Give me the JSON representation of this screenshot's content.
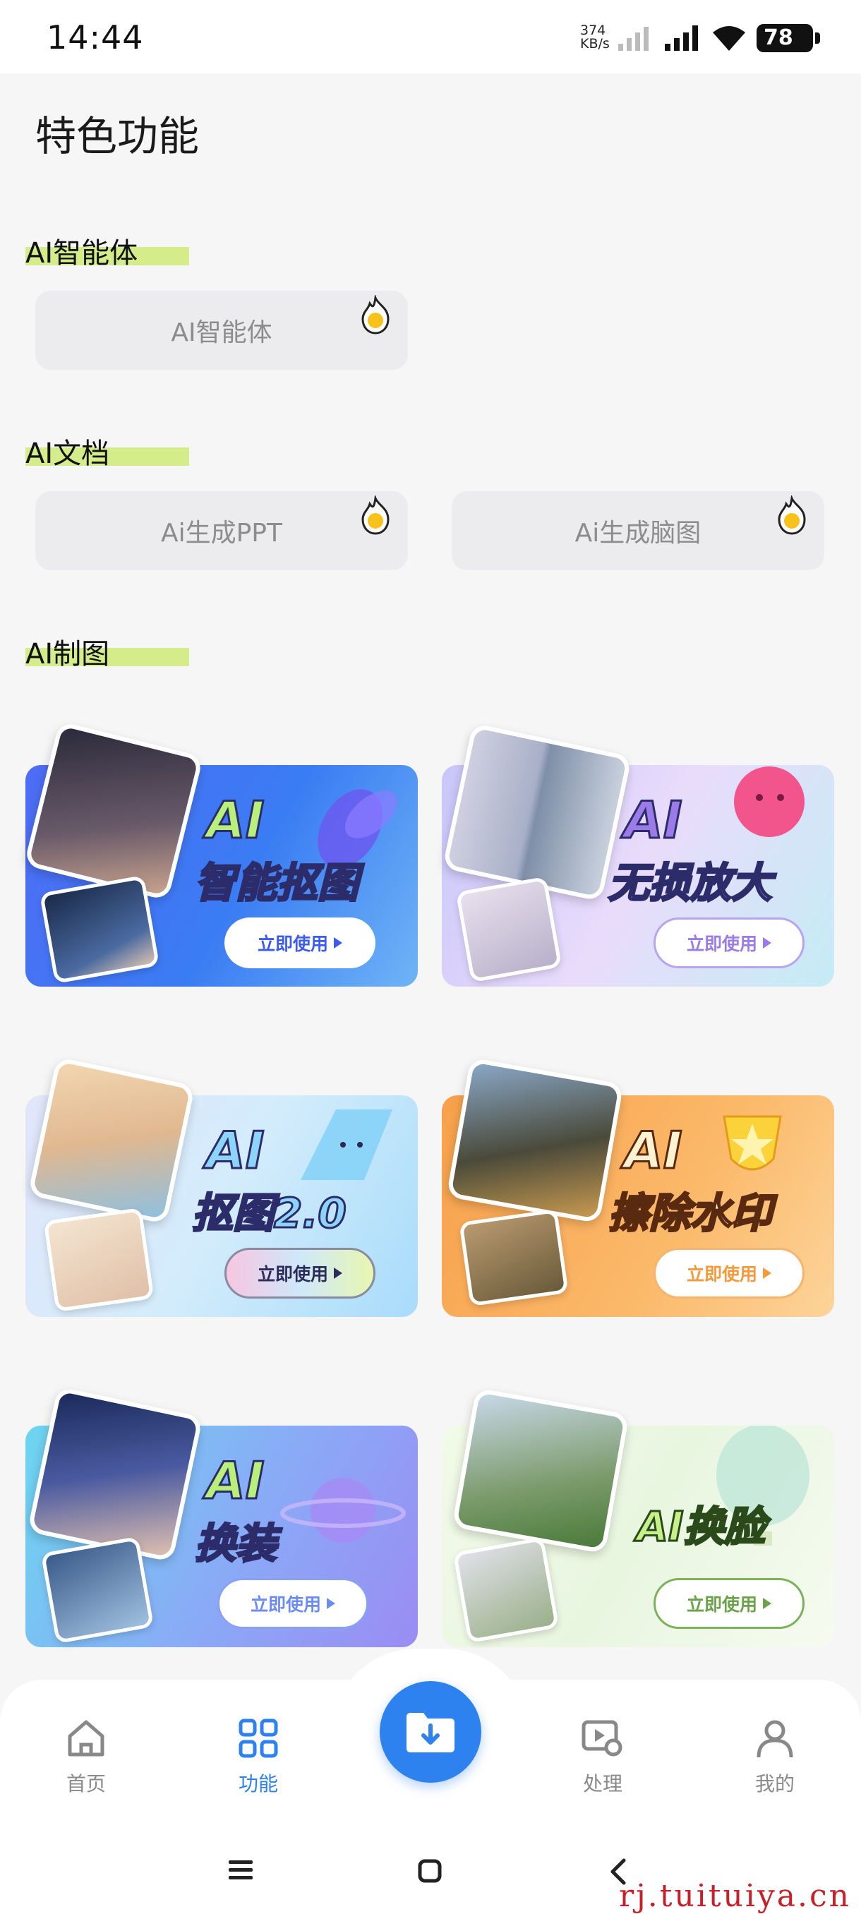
{
  "status_bar": {
    "time": "14:44",
    "net_speed_value": "374",
    "net_speed_unit": "KB/s",
    "battery": "78"
  },
  "page": {
    "title": "特色功能"
  },
  "sections": {
    "agent": {
      "title": "AI智能体",
      "items": [
        "AI智能体"
      ]
    },
    "docs": {
      "title": "AI文档",
      "items": [
        "Ai生成PPT",
        "Ai生成脑图"
      ]
    },
    "drawing": {
      "title": "AI制图"
    }
  },
  "cards": [
    {
      "line1": "AI",
      "line2": "智能抠图",
      "button": "立即使用",
      "accent": "#3d5bf0"
    },
    {
      "line1": "AI",
      "line2": "无损放大",
      "button": "立即使用",
      "accent": "#9a7be8"
    },
    {
      "line1": "AI",
      "line2": "抠图2.0",
      "button": "立即使用",
      "accent": "#5aa6f0"
    },
    {
      "line1": "AI",
      "line2": "擦除水印",
      "button": "立即使用",
      "accent": "#f59a3c"
    },
    {
      "line1": "AI",
      "line2": "换装",
      "button": "立即使用",
      "accent": "#6c8cf5"
    },
    {
      "line1": "",
      "line2": "AI换脸",
      "button": "立即使用",
      "accent": "#6aa34a"
    }
  ],
  "tabbar": {
    "items": [
      {
        "label": "首页",
        "icon": "home-icon"
      },
      {
        "label": "功能",
        "icon": "grid-icon"
      },
      {
        "label": "",
        "icon": "folder-download-icon"
      },
      {
        "label": "处理",
        "icon": "video-settings-icon"
      },
      {
        "label": "我的",
        "icon": "person-icon"
      }
    ],
    "active_color": "#2e82f0"
  },
  "watermark": "rj.tuituiya.cn"
}
